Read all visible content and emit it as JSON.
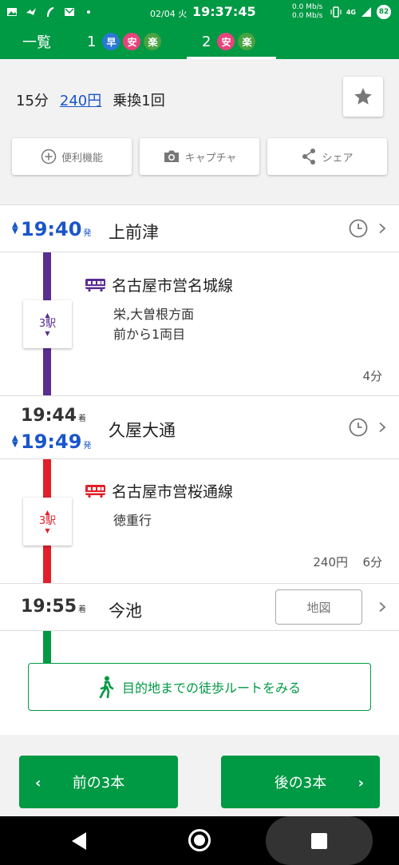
{
  "status_bar": {
    "date": "02/04 火",
    "time": "19:37:45",
    "speed_up": "0.0 Mb/s",
    "speed_down": "0.0 Mb/s",
    "network": "4G",
    "battery": "82"
  },
  "tabs": {
    "list_label": "一覧",
    "route1": {
      "number": "1",
      "badges": [
        "早",
        "安",
        "楽"
      ]
    },
    "route2": {
      "number": "2",
      "badges": [
        "安",
        "楽"
      ]
    }
  },
  "summary": {
    "duration": "15分",
    "fare": "240円",
    "transfers": "乗換1回"
  },
  "actions": {
    "tools": "便利機能",
    "capture": "キャプチャ",
    "share": "シェア"
  },
  "colors": {
    "brand": "#009944",
    "meijo_line": "#5a2d91",
    "sakuradori_line": "#e0202a",
    "walk_line": "#009944",
    "departure_time": "#1a56c9"
  },
  "route": {
    "stations": [
      {
        "name": "上前津",
        "depart": "19:40",
        "depart_suffix": "発"
      },
      {
        "name": "久屋大通",
        "arrive": "19:44",
        "arrive_suffix": "着",
        "depart": "19:49",
        "depart_suffix": "発"
      },
      {
        "name": "今池",
        "arrive": "19:55",
        "arrive_suffix": "着"
      }
    ],
    "legs": [
      {
        "line": "名古屋市営名城線",
        "stops": "3駅",
        "details": [
          "栄,大曽根方面",
          "前から1両目"
        ],
        "duration": "4分"
      },
      {
        "line": "名古屋市営桜通線",
        "stops": "3駅",
        "details": [
          "徳重行"
        ],
        "fare": "240円",
        "duration": "6分"
      }
    ],
    "map_label": "地図",
    "walk_label": "目的地までの徒歩ルートをみる"
  },
  "bottom": {
    "prev_label": "前の3本",
    "next_label": "後の3本"
  }
}
